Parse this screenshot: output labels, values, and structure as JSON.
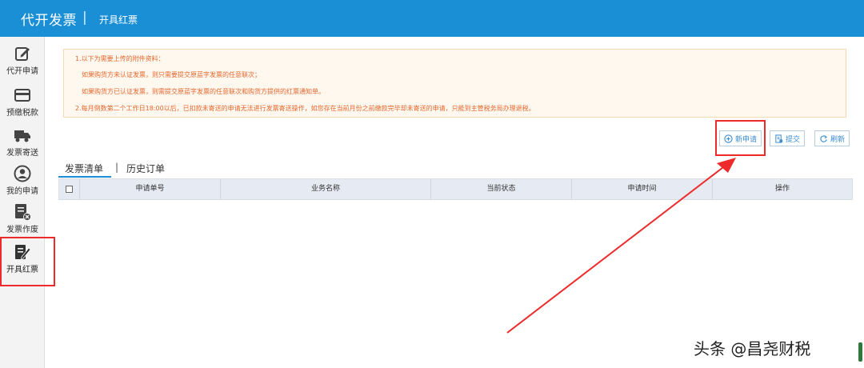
{
  "header": {
    "app_title": "代开发票",
    "divider": "|",
    "sub_title": "开具红票"
  },
  "sidebar": {
    "items": [
      {
        "label": "代开申请",
        "icon": "edit-icon"
      },
      {
        "label": "预缴税款",
        "icon": "card-icon"
      },
      {
        "label": "发票寄送",
        "icon": "truck-icon"
      },
      {
        "label": "我的申请",
        "icon": "user-icon"
      },
      {
        "label": "发票作废",
        "icon": "invoice-void-icon"
      },
      {
        "label": "开具红票",
        "icon": "red-invoice-icon"
      }
    ]
  },
  "notice": {
    "lines": [
      "1.以下为需要上传的附件资料：",
      "如果购货方未认证发票，则只需要提交原蓝字发票的任意联次；",
      "如果购货方已认证发票，则需提交原蓝字发票的任意联次和购货方提供的红票通知单。",
      "2.每月倒数第二个工作日18:00以后，已扣款未寄送的申请无法进行发票寄送操作，如您存在当前月份之前缴款完毕却未寄送的申请，只能到主管税务局办理退税。"
    ]
  },
  "toolbar": {
    "new_label": "新申请",
    "submit_label": "提交",
    "refresh_label": "刷新"
  },
  "tabs": {
    "invoice_list": "发票清单",
    "separator": "|",
    "history_orders": "历史订单"
  },
  "table": {
    "columns": [
      "申请单号",
      "业务名称",
      "当前状态",
      "申请时间",
      "操作"
    ]
  },
  "watermark": "头条 @昌尧财税",
  "colors": {
    "header": "#1a8fd6",
    "notice_text": "#e5672f",
    "highlight": "#ee2b2b"
  }
}
